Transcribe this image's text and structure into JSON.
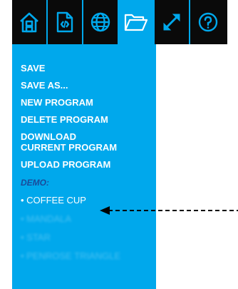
{
  "toolbar": {
    "buttons": [
      {
        "icon": "home-icon",
        "active": false
      },
      {
        "icon": "code-file-icon",
        "active": false
      },
      {
        "icon": "globe-icon",
        "active": false
      },
      {
        "icon": "folder-open-icon",
        "active": true
      },
      {
        "icon": "expand-arrows-icon",
        "active": false
      },
      {
        "icon": "help-icon",
        "active": false
      }
    ]
  },
  "menu": {
    "save": "SAVE",
    "save_as": "SAVE AS...",
    "new_program": "NEW PROGRAM",
    "delete_program": "DELETE PROGRAM",
    "download_current_program": "DOWNLOAD\nCURRENT PROGRAM",
    "upload_program": "UPLOAD PROGRAM",
    "demo_header": "DEMO:",
    "demo_items": [
      "• COFFEE CUP",
      "• MANDALA",
      "• STAR",
      "• PENROSE TRIANGLE"
    ]
  },
  "colors": {
    "toolbar_bg": "#0a0a0a",
    "accent": "#00a8ec",
    "section_header": "#1a4b9a"
  }
}
